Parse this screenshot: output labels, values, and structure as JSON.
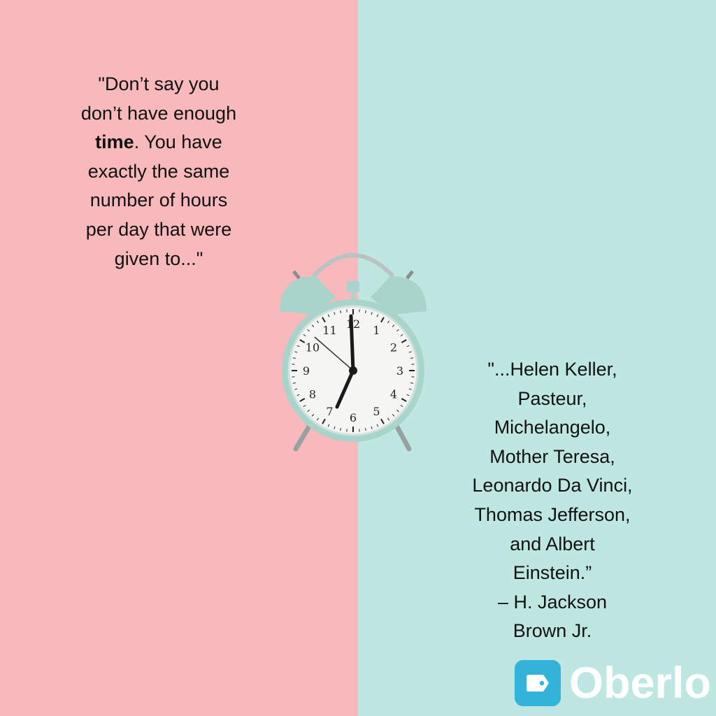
{
  "quote_left": {
    "line1": "\"Don’t say you\ndon’t have enough\n",
    "bold": "time",
    "line2": ". You have\nexactly the same\nnumber of hours\nper day that were\ngiven to...\""
  },
  "quote_right": {
    "text": "\"...Helen Keller,\nPasteur,\nMichelangelo,\nMother Teresa,\nLeonardo Da Vinci,\nThomas Jefferson,\nand Albert\nEinstein.”\n– H. Jackson\nBrown Jr."
  },
  "clock": {
    "numbers": [
      "12",
      "1",
      "2",
      "3",
      "4",
      "5",
      "6",
      "7",
      "8",
      "9",
      "10",
      "11"
    ],
    "icon": "alarm-clock"
  },
  "logo": {
    "text": "Oberlo",
    "icon": "tag-icon"
  },
  "colors": {
    "left_bg": "#f7b9bb",
    "right_bg": "#bfe7e2",
    "clock_body": "#a8d4cc",
    "logo_badge": "#34b3d8"
  }
}
